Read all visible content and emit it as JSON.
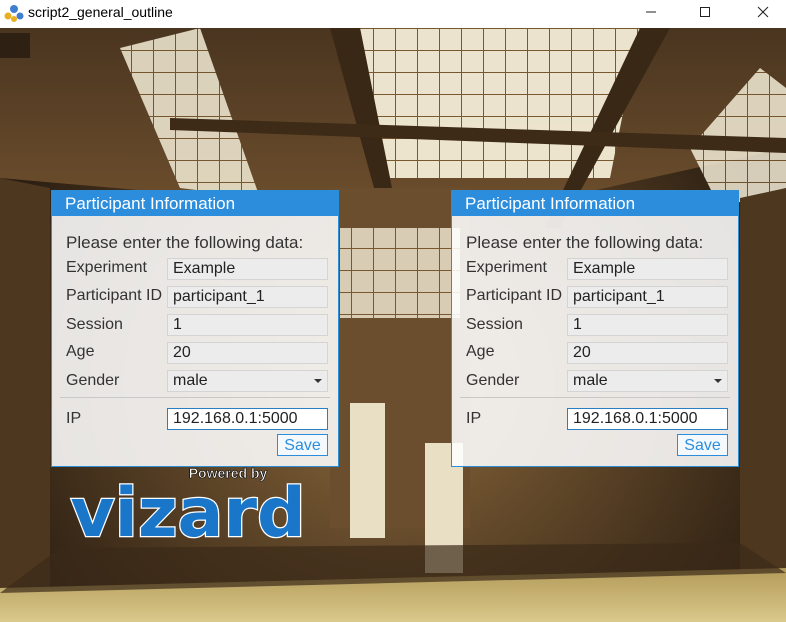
{
  "window": {
    "title": "script2_general_outline",
    "minimize": "—",
    "maximize": "☐",
    "close": "✕"
  },
  "panels": [
    {
      "header": "Participant Information",
      "prompt": "Please enter the following data:",
      "fields": {
        "experiment": {
          "label": "Experiment",
          "value": "Example"
        },
        "participant_id": {
          "label": "Participant ID",
          "value": "participant_1"
        },
        "session": {
          "label": "Session",
          "value": "1"
        },
        "age": {
          "label": "Age",
          "value": "20"
        },
        "gender": {
          "label": "Gender",
          "value": "male"
        },
        "ip": {
          "label": "IP",
          "value": "192.168.0.1:5000"
        }
      },
      "save": "Save"
    },
    {
      "header": "Participant Information",
      "prompt": "Please enter the following data:",
      "fields": {
        "experiment": {
          "label": "Experiment",
          "value": "Example"
        },
        "participant_id": {
          "label": "Participant ID",
          "value": "participant_1"
        },
        "session": {
          "label": "Session",
          "value": "1"
        },
        "age": {
          "label": "Age",
          "value": "20"
        },
        "gender": {
          "label": "Gender",
          "value": "male"
        },
        "ip": {
          "label": "IP",
          "value": "192.168.0.1:5000"
        }
      },
      "save": "Save"
    }
  ],
  "logo": {
    "tagline": "Powered by",
    "wordmark": "vizard"
  },
  "colors": {
    "accent": "#2c8ddc",
    "logo_blue": "#1976c8"
  }
}
